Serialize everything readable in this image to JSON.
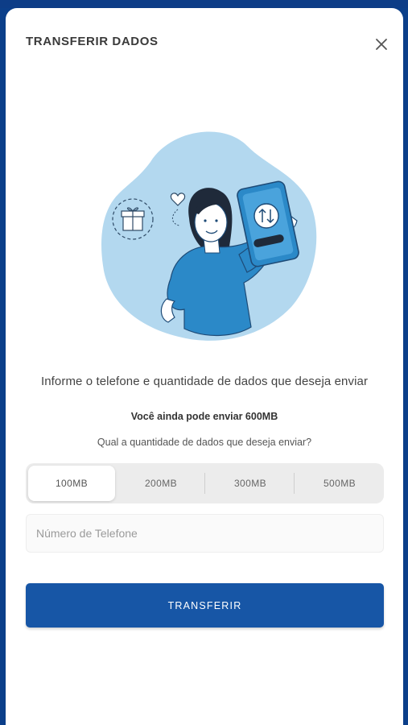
{
  "modal": {
    "title": "TRANSFERIR DADOS"
  },
  "content": {
    "heading": "Informe o telefone e quantidade de dados que deseja enviar",
    "remaining": "Você ainda pode enviar 600MB",
    "question": "Qual a quantidade de dados que deseja enviar?"
  },
  "options": [
    {
      "label": "100MB",
      "selected": true
    },
    {
      "label": "200MB",
      "selected": false
    },
    {
      "label": "300MB",
      "selected": false
    },
    {
      "label": "500MB",
      "selected": false
    }
  ],
  "phone": {
    "placeholder": "Número de Telefone",
    "value": ""
  },
  "submit_label": "TRANSFERIR",
  "colors": {
    "brand": "#0d3d87",
    "button": "#1756a6",
    "illustration_bg": "#b3d8ef"
  }
}
